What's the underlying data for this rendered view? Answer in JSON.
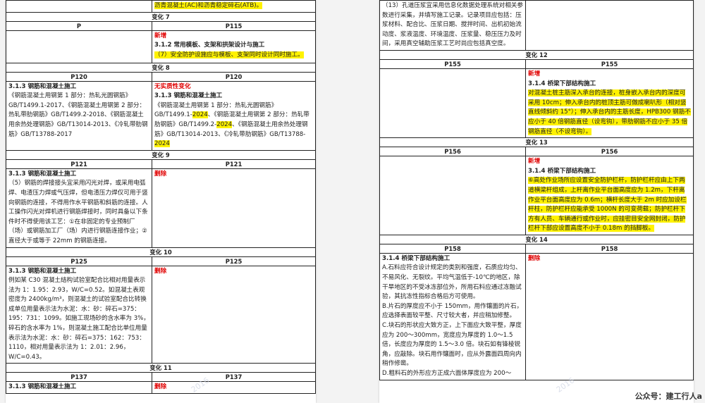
{
  "left": {
    "top_cont": "沥青混凝土(AC)和沥青稳定碎石(ATB)。",
    "c7": {
      "title": "变化 7",
      "hl": "P",
      "hr": "P115",
      "tag": "新增",
      "heading": "3.1.2 常用模板、支架和拱架设计与施工",
      "item": "（7）安全防护设施应与模板、支架同时设计同时施工。"
    },
    "c8": {
      "title": "变化 8",
      "hl": "P120",
      "hr": "P120",
      "l_heading": "3.1.3 钢筋和混凝土施工",
      "l_body": "《钢筋混凝土用钢第 1 部分：热轧光圆钢筋》GB/T1499.1-2017、《钢筋混凝土用钢第 2 部分：热轧带肋钢筋》GB/T1499.2-2018、《钢筋混凝土用余热处理钢筋》GB/T13014-2013、《冷轧带肋钢筋》GB/T13788-2017",
      "r_tag": "无实质性变化",
      "r_heading": "3.1.3 钢筋和混凝土施工",
      "r_a": "《钢筋混凝土用钢第 1 部分：热轧光圆钢筋》GB/T1499.1-",
      "r_y1": "2024",
      "r_b": "、《钢筋混凝土用钢第 2 部分：热轧带肋钢筋》GB/T1499.2-",
      "r_y2": "2024",
      "r_c": "、《钢筋混凝土用余热处理钢筋》GB/T13014-2013、《冷轧带肋钢筋》GB/T13788-",
      "r_y3": "2024"
    },
    "c9": {
      "title": "变化 9",
      "hl": "P121",
      "hr": "P121",
      "l_heading": "3.1.3 钢筋和混凝土施工",
      "l_body": "（5）钢筋的焊接接头宜采用闪光对焊，或采用电弧焊、电渣压力焊或气压焊，但电渣压力焊仅可用于竖向钢筋的连接，不得用作水平钢筋和斜筋的连接。人工操作闪光对焊机进行钢筋焊接时，同时具备以下条件时不得使用该工艺：①在非固定的专业预制厂（场）或钢筋加工厂（场）内进行钢筋连接作业；②直径大于或等于 22mm 的钢筋连接。",
      "r_tag": "删除"
    },
    "c10": {
      "title": "变化 10",
      "hl": "P125",
      "hr": "P125",
      "l_heading": "3.1.3 钢筋和混凝土施工",
      "l_body": "例如某 C30 混凝土结构试验室配合比相对用量表示法为 1：1.95：2.93，W/C=0.52。如混凝土表观密度为 2400kg/m³，则混凝土的试验室配合比转换成单位用量表示法为水泥：水：砂：碎石=375：195：731：1099。如施工现场砂的含水率为 3%，碎石的含水率为 1%，则混凝土施工配合比单位用量表示法为水泥：水：砂：碎石=375：162：753：1110，相对用量表示法为 1：2.01：2.96，W/C=0.43。",
      "r_tag": "删除"
    },
    "c11": {
      "title": "变化 11",
      "hl": "P137",
      "hr": "P137",
      "l_heading": "3.1.3 钢筋和混凝土施工",
      "r_tag": "删除"
    }
  },
  "right": {
    "top_cont": "（13）孔道压浆宜采用信息化数据处理系统对相关参数进行采集，并填写施工记录。记录项目应包括：压浆材料、配合比、压浆日期、搅拌时间、出机初始流动度、浆液温度、环境温度、压浆量、稳压压力及时间，采用真空辅助压浆工艺时尚应包括真空度。",
    "c12": {
      "title": "变化 12",
      "hl": "P155",
      "hr": "P155",
      "tag": "新增",
      "heading": "3.1.4 桥梁下部结构施工",
      "body": "对混凝土桩主筋深入承台的连接，桩身嵌入承台内的深度可采用 10cm；伸入承台内的桩顶主筋可做成喇叭形（相对竖直线倾斜约 15°）；伸入承台内的主筋长度，HPB300 钢筋不应小于 40 倍钢筋直径（设弯钩），带肋钢筋不应小于 35 倍钢筋直径（不设弯钩）。"
    },
    "c13": {
      "title": "变化 13",
      "hl": "P156",
      "hr": "P156",
      "tag": "新增",
      "heading": "3.1.4 桥梁下部结构施工",
      "body": "⑥高处作业场所应设置安全防护栏杆，防护栏杆应由上下两道横梁杆组成，上杆离作业平台面高度应为 1.2m，下杆离作业平台面高度应为 0.6m；横杆长度大于 2m 时应加设栏杆柱，防护栏杆应能承受 1000N 的可变荷载；防护栏杆下方有人员、车辆通行或作业时，应挂密目安全网封闭，防护栏杆下部应设置高度不小于 0.18m 的挡脚板。"
    },
    "c14": {
      "title": "变化 14",
      "hl": "P158",
      "hr": "P158",
      "l_heading": "3.1.4 桥梁下部结构施工",
      "l_a": "A.石料应符合设计规定的类别和强度，石质应均匀、不易风化、无裂纹。平均气温低于-10℃的地区，除干旱地区的不受冰冻部位外，所用石料应通过冻融试验，其抗冻性指标合格后方可使用。",
      "l_b": "B.片石的厚度应不小于 150mm，用作镶面的片石，应选择表面较平整、尺寸较大者，并应稍加修整。",
      "l_c": "C.块石的形状应大致方正，上下面应大致平整，厚度应为 200～300mm，宽度应为厚度的 1.0～1.5 倍，长度应为厚度的 1.5～3.0 倍。块石如有锋棱锐角，应敲除。块石用作镶面时，应从外露面四周向内稍作修凿。",
      "l_d": "D.粗料石的外形应方正成六面体厚度应为 200～",
      "r_tag": "删除"
    },
    "footer": "公众号：建工行人a"
  },
  "watermarks": [
    "2016",
    "2016"
  ]
}
